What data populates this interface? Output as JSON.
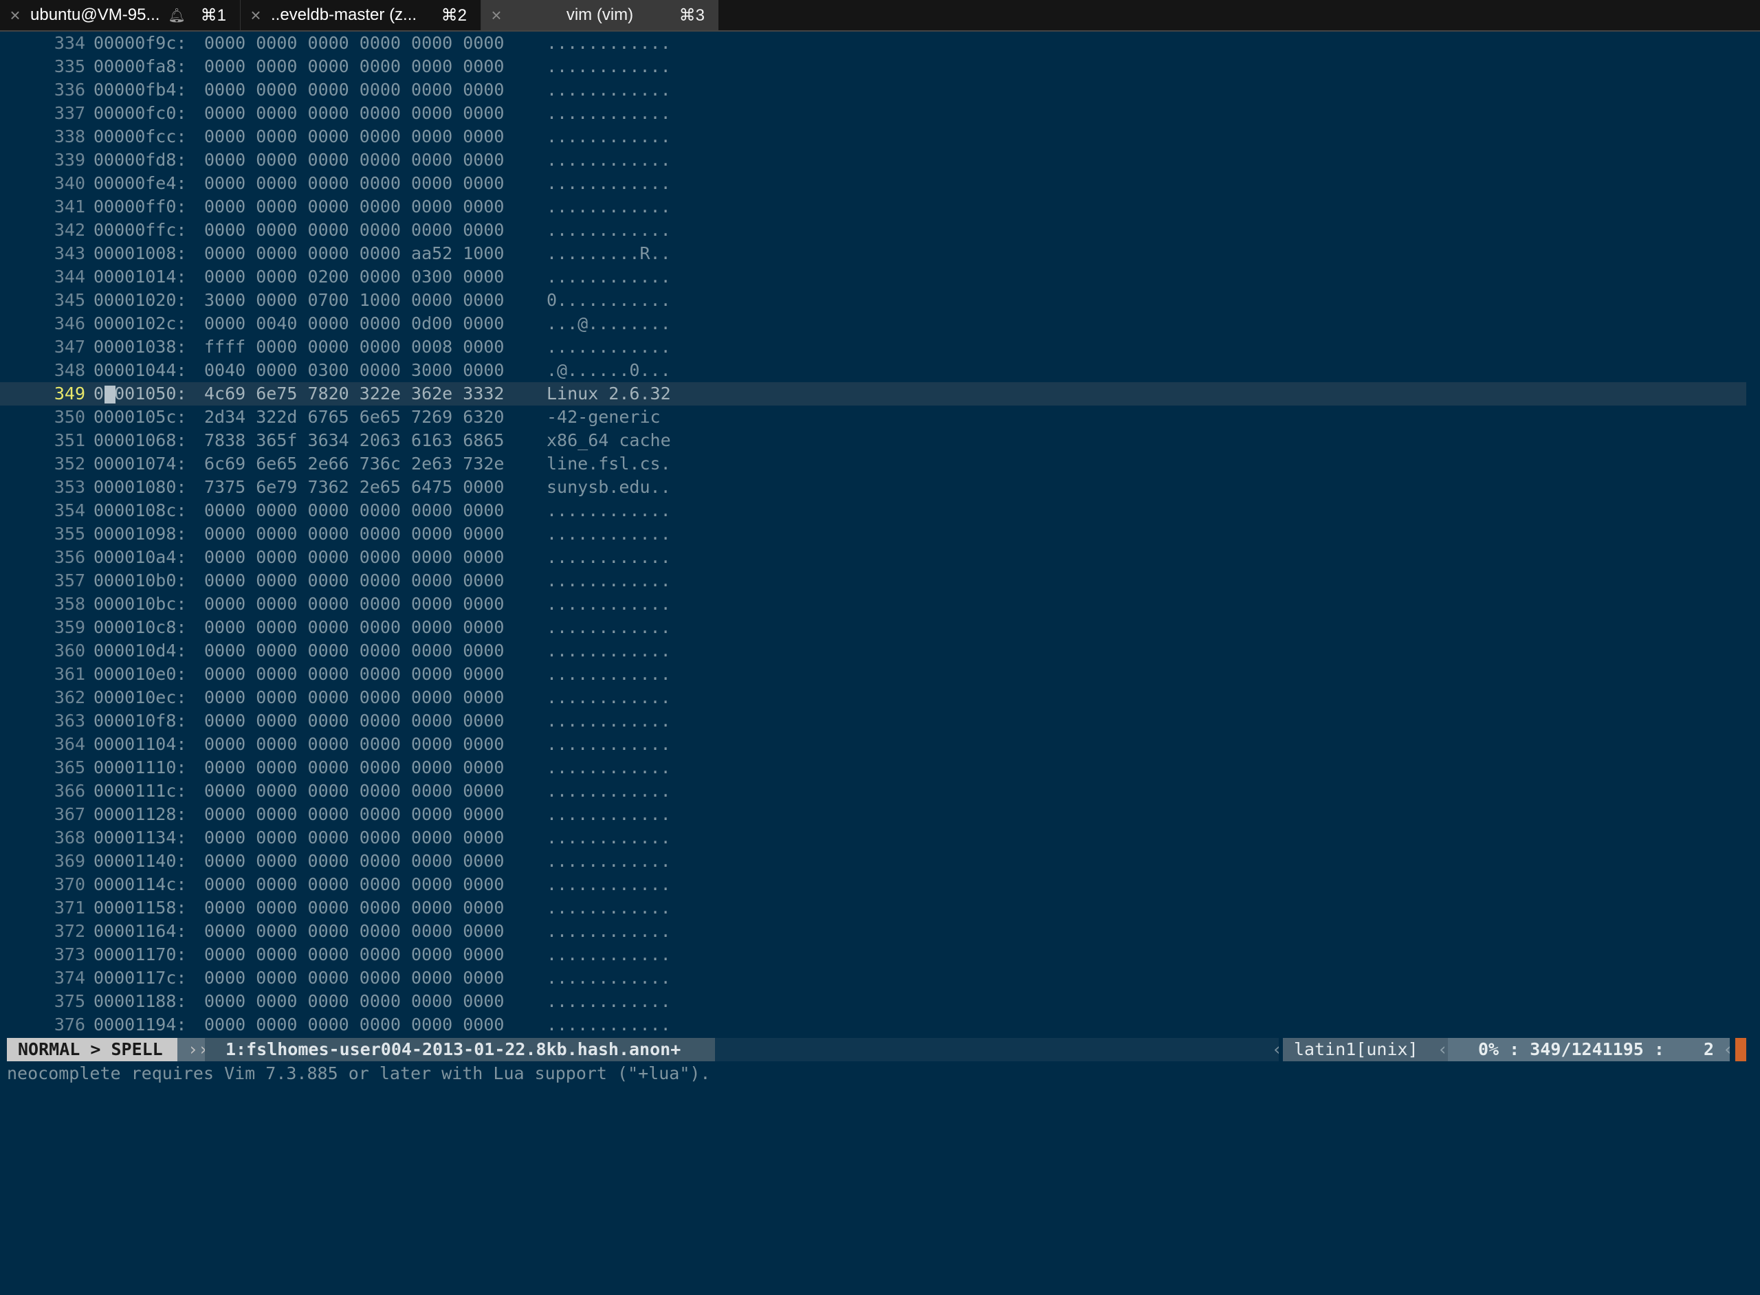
{
  "tabs": [
    {
      "title": "ubuntu@VM-95...",
      "shortcut": "⌘1"
    },
    {
      "title": "..eveldb-master (z...",
      "shortcut": "⌘2"
    },
    {
      "title": "vim (vim)",
      "shortcut": "⌘3"
    }
  ],
  "rows": [
    {
      "ln": "334",
      "addr": "00000f9c:",
      "hex": "0000 0000 0000 0000 0000 0000",
      "ascii": "............"
    },
    {
      "ln": "335",
      "addr": "00000fa8:",
      "hex": "0000 0000 0000 0000 0000 0000",
      "ascii": "............"
    },
    {
      "ln": "336",
      "addr": "00000fb4:",
      "hex": "0000 0000 0000 0000 0000 0000",
      "ascii": "............"
    },
    {
      "ln": "337",
      "addr": "00000fc0:",
      "hex": "0000 0000 0000 0000 0000 0000",
      "ascii": "............"
    },
    {
      "ln": "338",
      "addr": "00000fcc:",
      "hex": "0000 0000 0000 0000 0000 0000",
      "ascii": "............"
    },
    {
      "ln": "339",
      "addr": "00000fd8:",
      "hex": "0000 0000 0000 0000 0000 0000",
      "ascii": "............"
    },
    {
      "ln": "340",
      "addr": "00000fe4:",
      "hex": "0000 0000 0000 0000 0000 0000",
      "ascii": "............"
    },
    {
      "ln": "341",
      "addr": "00000ff0:",
      "hex": "0000 0000 0000 0000 0000 0000",
      "ascii": "............"
    },
    {
      "ln": "342",
      "addr": "00000ffc:",
      "hex": "0000 0000 0000 0000 0000 0000",
      "ascii": "............"
    },
    {
      "ln": "343",
      "addr": "00001008:",
      "hex": "0000 0000 0000 0000 aa52 1000",
      "ascii": ".........R.."
    },
    {
      "ln": "344",
      "addr": "00001014:",
      "hex": "0000 0000 0200 0000 0300 0000",
      "ascii": "............"
    },
    {
      "ln": "345",
      "addr": "00001020:",
      "hex": "3000 0000 0700 1000 0000 0000",
      "ascii": "0..........."
    },
    {
      "ln": "346",
      "addr": "0000102c:",
      "hex": "0000 0040 0000 0000 0d00 0000",
      "ascii": "...@........"
    },
    {
      "ln": "347",
      "addr": "00001038:",
      "hex": "ffff 0000 0000 0000 0008 0000",
      "ascii": "............"
    },
    {
      "ln": "348",
      "addr": "00001044:",
      "hex": "0040 0000 0300 0000 3000 0000",
      "ascii": ".@......0..."
    },
    {
      "ln": "349",
      "addr": "00001050:",
      "hex": "4c69 6e75 7820 322e 362e 3332",
      "ascii": "Linux 2.6.32"
    },
    {
      "ln": "350",
      "addr": "0000105c:",
      "hex": "2d34 322d 6765 6e65 7269 6320",
      "ascii": "-42-generic "
    },
    {
      "ln": "351",
      "addr": "00001068:",
      "hex": "7838 365f 3634 2063 6163 6865",
      "ascii": "x86_64 cache"
    },
    {
      "ln": "352",
      "addr": "00001074:",
      "hex": "6c69 6e65 2e66 736c 2e63 732e",
      "ascii": "line.fsl.cs."
    },
    {
      "ln": "353",
      "addr": "00001080:",
      "hex": "7375 6e79 7362 2e65 6475 0000",
      "ascii": "sunysb.edu.."
    },
    {
      "ln": "354",
      "addr": "0000108c:",
      "hex": "0000 0000 0000 0000 0000 0000",
      "ascii": "............"
    },
    {
      "ln": "355",
      "addr": "00001098:",
      "hex": "0000 0000 0000 0000 0000 0000",
      "ascii": "............"
    },
    {
      "ln": "356",
      "addr": "000010a4:",
      "hex": "0000 0000 0000 0000 0000 0000",
      "ascii": "............"
    },
    {
      "ln": "357",
      "addr": "000010b0:",
      "hex": "0000 0000 0000 0000 0000 0000",
      "ascii": "............"
    },
    {
      "ln": "358",
      "addr": "000010bc:",
      "hex": "0000 0000 0000 0000 0000 0000",
      "ascii": "............"
    },
    {
      "ln": "359",
      "addr": "000010c8:",
      "hex": "0000 0000 0000 0000 0000 0000",
      "ascii": "............"
    },
    {
      "ln": "360",
      "addr": "000010d4:",
      "hex": "0000 0000 0000 0000 0000 0000",
      "ascii": "............"
    },
    {
      "ln": "361",
      "addr": "000010e0:",
      "hex": "0000 0000 0000 0000 0000 0000",
      "ascii": "............"
    },
    {
      "ln": "362",
      "addr": "000010ec:",
      "hex": "0000 0000 0000 0000 0000 0000",
      "ascii": "............"
    },
    {
      "ln": "363",
      "addr": "000010f8:",
      "hex": "0000 0000 0000 0000 0000 0000",
      "ascii": "............"
    },
    {
      "ln": "364",
      "addr": "00001104:",
      "hex": "0000 0000 0000 0000 0000 0000",
      "ascii": "............"
    },
    {
      "ln": "365",
      "addr": "00001110:",
      "hex": "0000 0000 0000 0000 0000 0000",
      "ascii": "............"
    },
    {
      "ln": "366",
      "addr": "0000111c:",
      "hex": "0000 0000 0000 0000 0000 0000",
      "ascii": "............"
    },
    {
      "ln": "367",
      "addr": "00001128:",
      "hex": "0000 0000 0000 0000 0000 0000",
      "ascii": "............"
    },
    {
      "ln": "368",
      "addr": "00001134:",
      "hex": "0000 0000 0000 0000 0000 0000",
      "ascii": "............"
    },
    {
      "ln": "369",
      "addr": "00001140:",
      "hex": "0000 0000 0000 0000 0000 0000",
      "ascii": "............"
    },
    {
      "ln": "370",
      "addr": "0000114c:",
      "hex": "0000 0000 0000 0000 0000 0000",
      "ascii": "............"
    },
    {
      "ln": "371",
      "addr": "00001158:",
      "hex": "0000 0000 0000 0000 0000 0000",
      "ascii": "............"
    },
    {
      "ln": "372",
      "addr": "00001164:",
      "hex": "0000 0000 0000 0000 0000 0000",
      "ascii": "............"
    },
    {
      "ln": "373",
      "addr": "00001170:",
      "hex": "0000 0000 0000 0000 0000 0000",
      "ascii": "............"
    },
    {
      "ln": "374",
      "addr": "0000117c:",
      "hex": "0000 0000 0000 0000 0000 0000",
      "ascii": "............"
    },
    {
      "ln": "375",
      "addr": "00001188:",
      "hex": "0000 0000 0000 0000 0000 0000",
      "ascii": "............"
    },
    {
      "ln": "376",
      "addr": "00001194:",
      "hex": "0000 0000 0000 0000 0000 0000",
      "ascii": "............"
    }
  ],
  "current_line": "349",
  "status": {
    "mode": "NORMAL > SPELL",
    "filename": "1:fslhomes-user004-2013-01-22.8kb.hash.anon+",
    "encoding": "latin1[unix]",
    "position": "0% : 349/1241195 :",
    "column": "2"
  },
  "message": "neocomplete requires Vim 7.3.885 or later with Lua support (\"+lua\").",
  "colors": {
    "background": "#002b47",
    "current_line_number": "#e9e76a",
    "warning": "#d0642a"
  }
}
